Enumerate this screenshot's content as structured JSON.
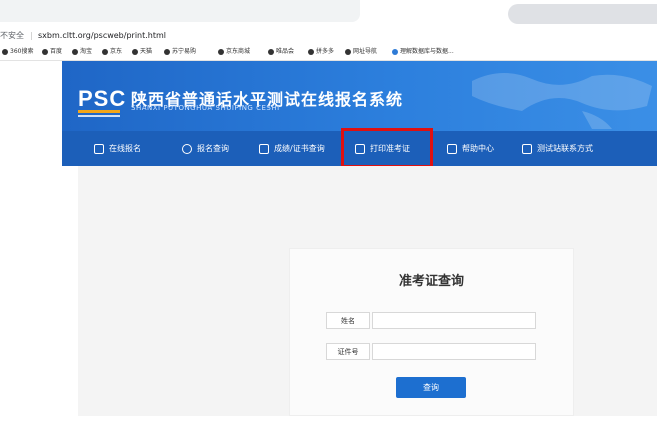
{
  "browser": {
    "insecure_label": "不安全",
    "url": "sxbm.cltt.org/pscweb/print.html",
    "bookmarks": [
      "360搜索",
      "百度",
      "淘宝",
      "京东",
      "天猫",
      "苏宁易购",
      "京东商城",
      "唯品会",
      "拼多多",
      "网址导航",
      "理解数据库与数据..."
    ]
  },
  "header": {
    "logo": "PSC",
    "title": "陕西省普通话水平测试在线报名系统",
    "subtitle": "SHANXI PUTONGHUA SHUIPING CESHI",
    "brand_color": "#1f66c6",
    "accent_color": "#f3a619"
  },
  "nav": {
    "items": [
      {
        "label": "在线报名",
        "icon": "edit-icon"
      },
      {
        "label": "报名查询",
        "icon": "search-icon"
      },
      {
        "label": "成绩/证书查询",
        "icon": "certificate-search-icon"
      },
      {
        "label": "打印准考证",
        "icon": "printer-icon"
      },
      {
        "label": "帮助中心",
        "icon": "help-icon"
      },
      {
        "label": "测试站联系方式",
        "icon": "contact-icon"
      }
    ],
    "highlight_color": "#e01010"
  },
  "form": {
    "title": "准考证查询",
    "name_label": "姓名",
    "name_value": "",
    "id_label": "证件号",
    "id_value": "",
    "submit_label": "查询"
  }
}
